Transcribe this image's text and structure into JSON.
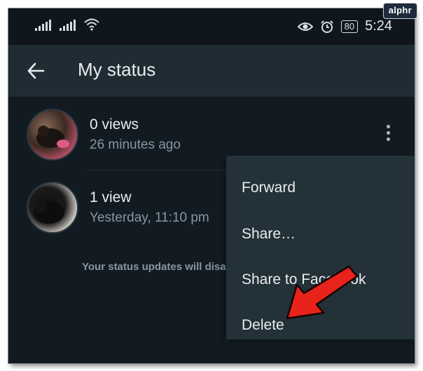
{
  "watermark": "alphr",
  "status_bar": {
    "time": "5:24",
    "battery": "80",
    "icons": [
      "signal-icon",
      "signal-icon",
      "wifi-icon",
      "eye-icon",
      "alarm-icon",
      "battery-icon"
    ]
  },
  "app_bar": {
    "title": "My status",
    "back_icon": "arrow-left-icon"
  },
  "statuses": [
    {
      "title": "0 views",
      "subtitle": "26 minutes ago"
    },
    {
      "title": "1 view",
      "subtitle": "Yesterday, 11:10 pm"
    }
  ],
  "footer_text": "Your status updates will disa",
  "context_menu": {
    "items": [
      "Forward",
      "Share…",
      "Share to Facebook",
      "Delete"
    ]
  },
  "annotation": {
    "arrow_color": "#e8231b"
  }
}
